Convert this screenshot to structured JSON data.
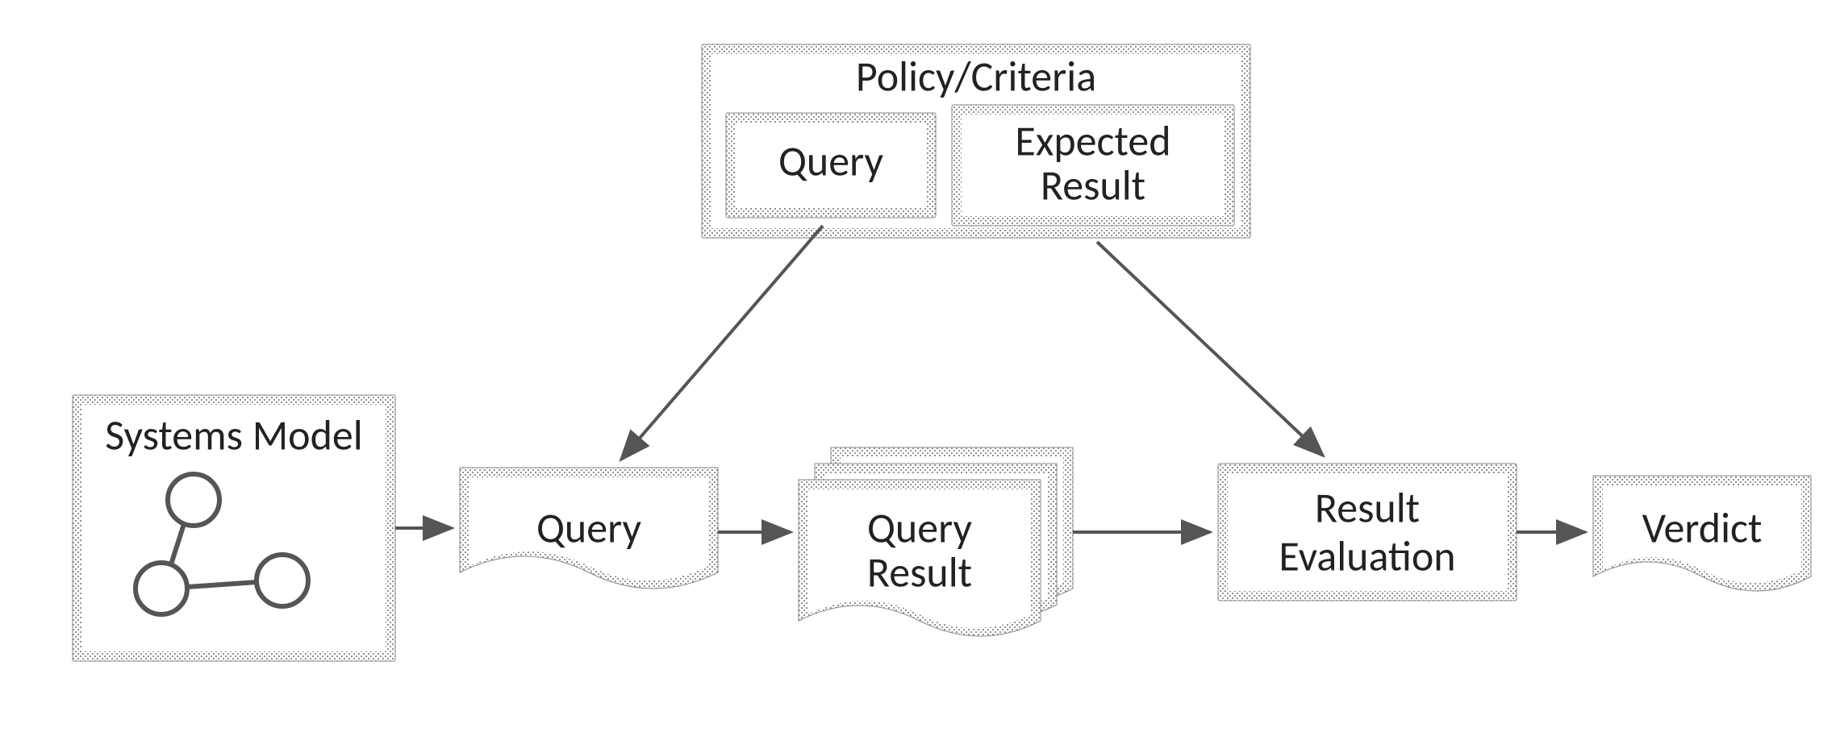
{
  "diagram": {
    "policy_box": {
      "title": "Policy/Criteria",
      "query": "Query",
      "expected_line1": "Expected",
      "expected_line2": "Result"
    },
    "systems_model": "Systems Model",
    "query": "Query",
    "query_result_line1": "Query",
    "query_result_line2": "Result",
    "result_eval_line1": "Result",
    "result_eval_line2": "Evaluation",
    "verdict": "Verdict"
  }
}
